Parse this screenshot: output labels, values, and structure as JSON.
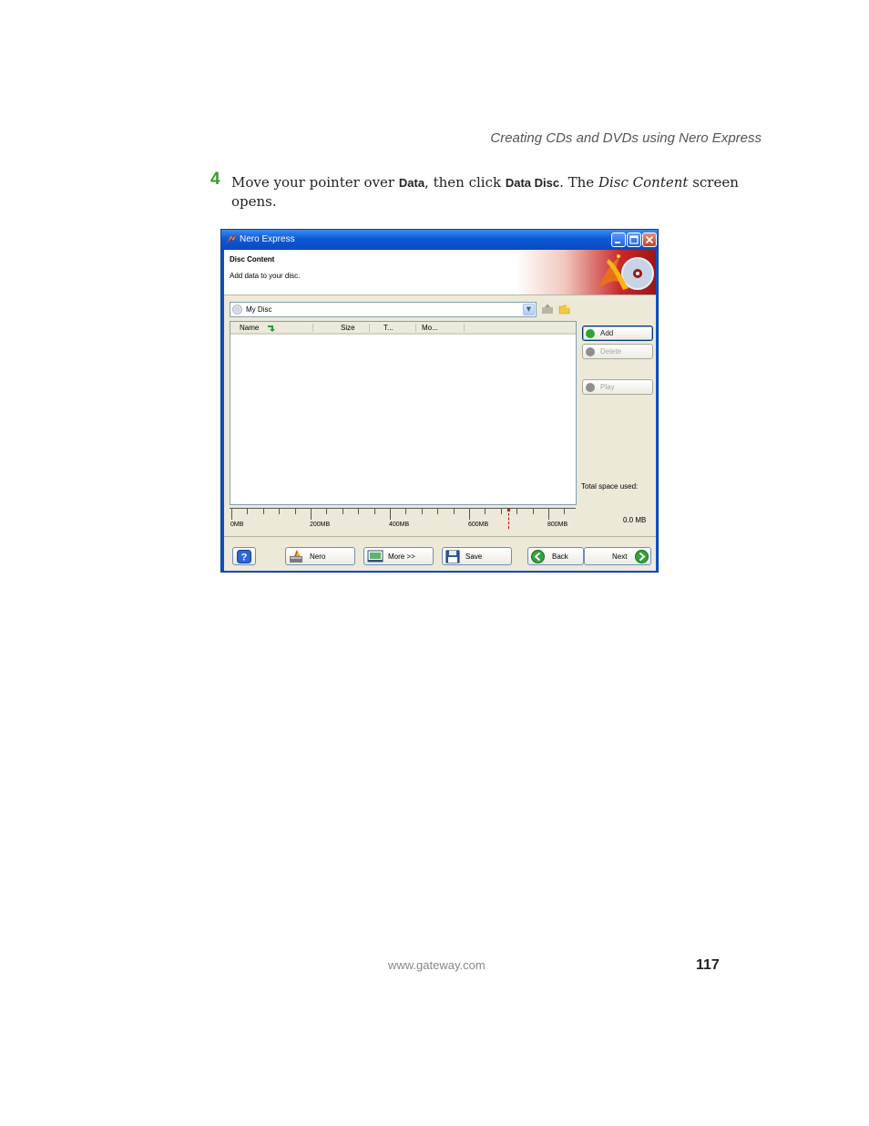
{
  "page": {
    "running_head": "Creating CDs and DVDs using Nero Express",
    "step_number": "4",
    "step_text": {
      "part1": "Move your pointer over ",
      "data_term": "Data",
      "part2": ", then click ",
      "data_disc_term": "Data Disc",
      "part3": ". The ",
      "disc_content_term": "Disc Content",
      "part4": " screen opens."
    },
    "footer_url": "www.gateway.com",
    "page_number": "117"
  },
  "window": {
    "title": "Nero Express",
    "header_title": "Disc Content",
    "header_subtitle": "Add data to your disc.",
    "disc_selector_value": "My Disc",
    "columns": [
      "Name",
      "Size",
      "T...",
      "Mo..."
    ],
    "side_buttons": {
      "add": "Add",
      "delete": "Delete",
      "play": "Play"
    },
    "total_space_label": "Total space used:",
    "total_space_value": "0.0 MB",
    "ruler_labels": [
      "0MB",
      "200MB",
      "400MB",
      "600MB",
      "800MB"
    ],
    "bottom_buttons": {
      "nero": "Nero",
      "more": "More >>",
      "save": "Save",
      "back": "Back",
      "next": "Next"
    }
  },
  "colors": {
    "step_number": "#3a9a2a",
    "titlebar": "#0c5ad8",
    "dialog_face": "#ece9d8",
    "accent_red": "#c8282a"
  }
}
